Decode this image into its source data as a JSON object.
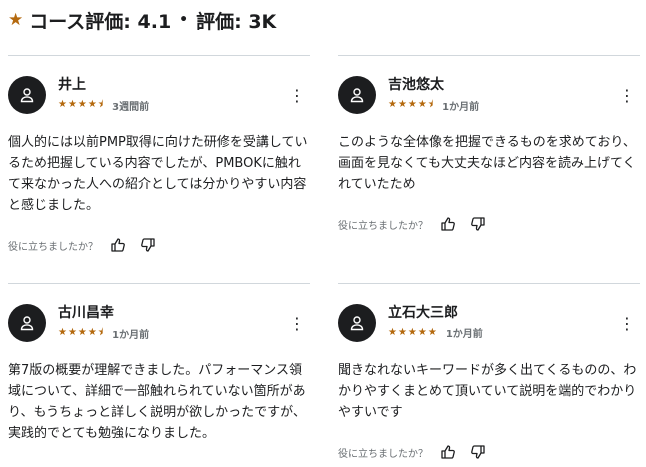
{
  "header": {
    "title": "コース評価: 4.1",
    "separator": "•",
    "rating_count": "評価: 3K"
  },
  "colors": {
    "star": "#b4690e",
    "avatar": "#1c1d1f",
    "divider": "#d1d7dc"
  },
  "reviews": [
    {
      "name": "井上",
      "stars": "★★★★⯨",
      "time": "3週間前",
      "text": "個人的には以前PMP取得に向けた研修を受講しているため把握している内容でしたが、PMBOKに触れて来なかった人への紹介としては分かりやすい内容と感じました。",
      "helpful": "役に立ちましたか？"
    },
    {
      "name": "吉池悠太",
      "stars": "★★★★⯨",
      "time": "1か月前",
      "text": "このような全体像を把握できるものを求めており、画面を見なくても大丈夫なほど内容を読み上げてくれていたため",
      "helpful": "役に立ちましたか？"
    },
    {
      "name": "古川昌幸",
      "stars": "★★★★⯨",
      "time": "1か月前",
      "text": "第7版の概要が理解できました。パフォーマンス領域について、詳細で一部触れられていない箇所があり、もうちょっと詳しく説明が欲しかったですが、実践的でとても勉強になりました。",
      "helpful": "役に立ちましたか？"
    },
    {
      "name": "立石大三郎",
      "stars": "★★★★★",
      "time": "1か月前",
      "text": "聞きなれないキーワードが多く出てくるものの、わかりやすくまとめて頂いていて説明を端的でわかりやすいです",
      "helpful": "役に立ちましたか？"
    }
  ]
}
